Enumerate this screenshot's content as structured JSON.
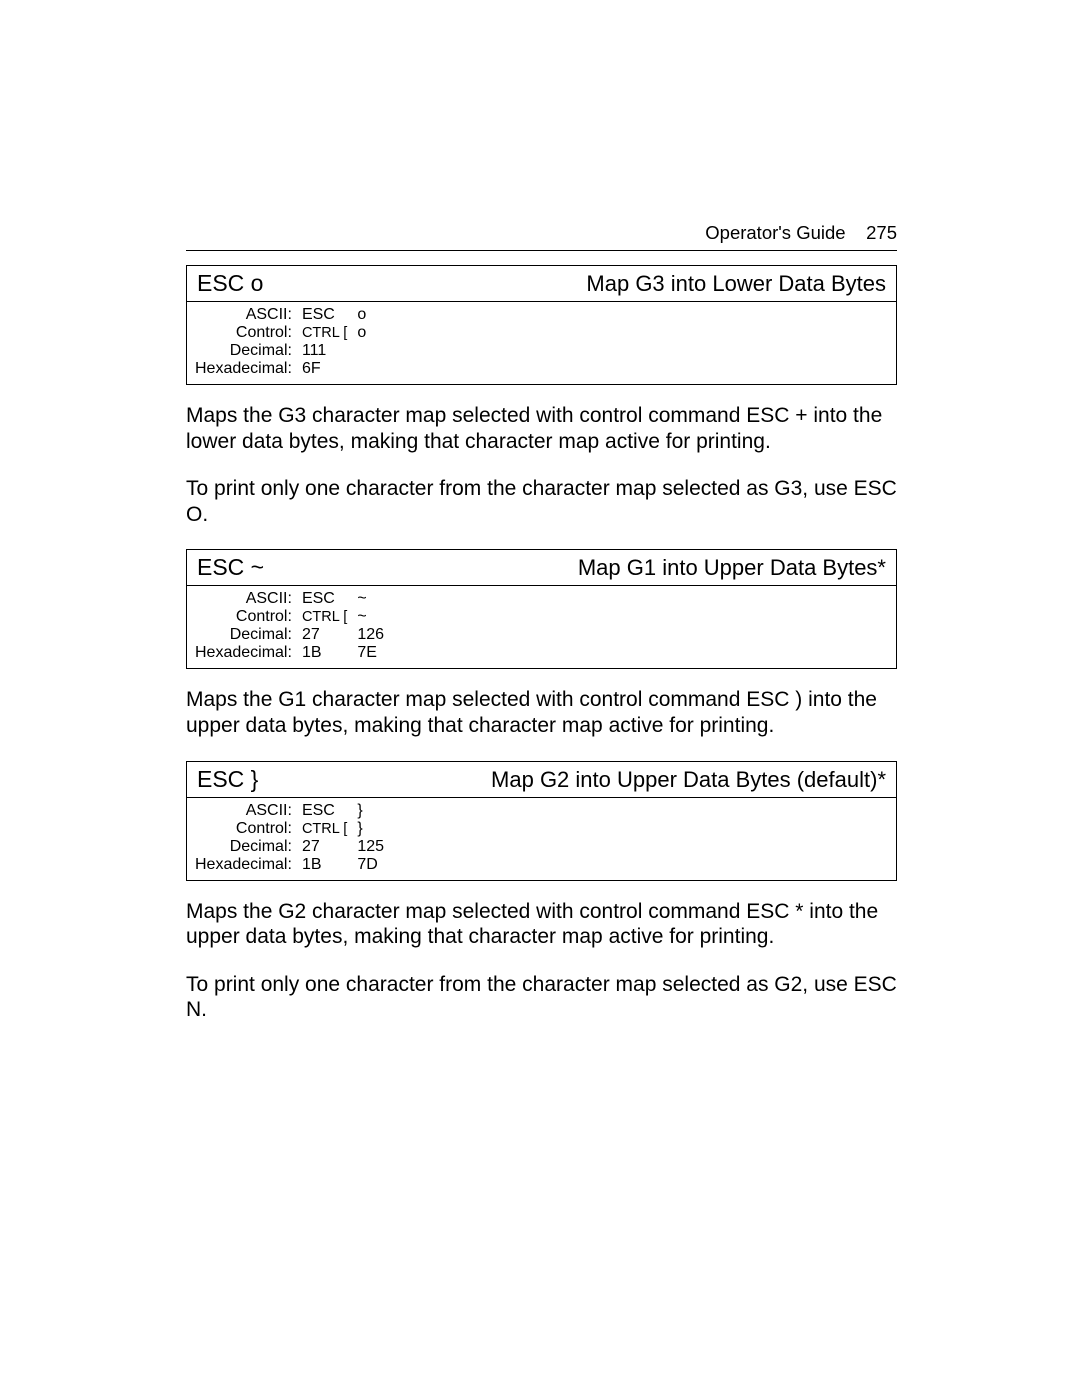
{
  "header": {
    "title": "Operator's Guide",
    "page": "275"
  },
  "sections": [
    {
      "cmd_name": "ESC o",
      "cmd_title": "Map G3 into Lower Data Bytes",
      "rows": {
        "ascii": {
          "label": "ASCII:",
          "c1": "ESC",
          "c2": "o"
        },
        "control": {
          "label": "Control:",
          "c1": "CTRL [",
          "c2": "o"
        },
        "decimal": {
          "label": "Decimal:",
          "c1": "111",
          "c2": ""
        },
        "hex": {
          "label": "Hexadecimal:",
          "c1": "6F",
          "c2": ""
        }
      },
      "paras": [
        "Maps the G3 character map selected with control command ESC + into the lower data bytes, making that character map active for printing.",
        "To print only one character from the character map selected as G3, use ESC O."
      ]
    },
    {
      "cmd_name": "ESC ~",
      "cmd_title": "Map G1 into Upper Data Bytes*",
      "rows": {
        "ascii": {
          "label": "ASCII:",
          "c1": "ESC",
          "c2": "~"
        },
        "control": {
          "label": "Control:",
          "c1": "CTRL [",
          "c2": "~"
        },
        "decimal": {
          "label": "Decimal:",
          "c1": "27",
          "c2": "126"
        },
        "hex": {
          "label": "Hexadecimal:",
          "c1": "1B",
          "c2": "7E"
        }
      },
      "paras": [
        "Maps the G1 character map selected with control command ESC ) into the upper data bytes, making that character map active for printing."
      ]
    },
    {
      "cmd_name": "ESC }",
      "cmd_title": "Map G2 into Upper Data Bytes (default)*",
      "rows": {
        "ascii": {
          "label": "ASCII:",
          "c1": "ESC",
          "c2": "}"
        },
        "control": {
          "label": "Control:",
          "c1": "CTRL [",
          "c2": "}"
        },
        "decimal": {
          "label": "Decimal:",
          "c1": "27",
          "c2": "125"
        },
        "hex": {
          "label": "Hexadecimal:",
          "c1": "1B",
          "c2": "7D"
        }
      },
      "paras": [
        "Maps the G2 character map selected with control command ESC * into the upper data bytes, making that character map active for printing.",
        "To print only one character from the character map selected as G2, use ESC N."
      ]
    }
  ]
}
